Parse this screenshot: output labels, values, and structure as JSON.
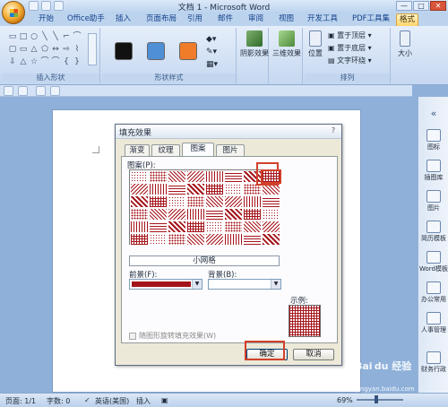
{
  "window": {
    "title": "文档 1 - Microsoft Word",
    "controls": [
      "—",
      "□",
      "✕"
    ]
  },
  "tabs": [
    {
      "label": "开始"
    },
    {
      "label": "Office助手"
    },
    {
      "label": "插入"
    },
    {
      "label": "页面布局"
    },
    {
      "label": "引用"
    },
    {
      "label": "邮件"
    },
    {
      "label": "审阅"
    },
    {
      "label": "视图"
    },
    {
      "label": "开发工具"
    },
    {
      "label": "PDF工具集"
    },
    {
      "label": "格式",
      "active": true
    }
  ],
  "ribbon": {
    "groups": [
      {
        "label": "插入形状"
      },
      {
        "label": "形状样式"
      },
      {
        "label": "阴影效果"
      },
      {
        "label": "三维效果"
      },
      {
        "label": "排列"
      },
      {
        "label": "大小"
      }
    ],
    "shapes": [
      "▭",
      "□",
      "○",
      "╲",
      "╲",
      "⌐",
      "⌒",
      "▢",
      "▭",
      "△",
      "⬠",
      "↔",
      "⇨",
      "⌇",
      "⇩",
      "△",
      "☆",
      "⌒",
      "⌒",
      "{",
      "}"
    ],
    "swatch_colors": [
      "#111111",
      "#4f8fd6",
      "#f07c2a"
    ],
    "shadow_label": "阴影效果",
    "three_d_label": "三维效果",
    "position_label": "位置",
    "arrange_items": [
      "置于顶层",
      "置于底层",
      "文字环绕"
    ],
    "size_label": "大小"
  },
  "sidebar": {
    "items": [
      {
        "label": "图标"
      },
      {
        "label": "插图库"
      },
      {
        "label": "图片"
      },
      {
        "label": "简历模板"
      },
      {
        "label": "Word模板"
      },
      {
        "label": "办公常用"
      },
      {
        "label": "人事管理"
      },
      {
        "label": "财务行政"
      }
    ]
  },
  "dialog": {
    "title": "填充效果",
    "close": "?",
    "tabs": [
      {
        "label": "渐变"
      },
      {
        "label": "纹理"
      },
      {
        "label": "图案",
        "active": true
      },
      {
        "label": "图片"
      }
    ],
    "pattern_label": "图案(P):",
    "selected_pattern": "小网格",
    "foreground_label": "前景(F):",
    "background_label": "背景(B):",
    "foreground_color": "#a4141b",
    "background_color": "#ffffff",
    "pattern_color": "#a4141b",
    "sample_label": "示例:",
    "rotate_label": "随图形旋转填充效果(W)",
    "ok": "确定",
    "cancel": "取消"
  },
  "statusbar": {
    "page": "页面: 1/1",
    "words": "字数: 0",
    "language": "英语(美国)",
    "mode": "插入",
    "zoom": "69%"
  },
  "watermark": {
    "text": "Bai du 经验",
    "url": "jingyan.baidu.com"
  }
}
